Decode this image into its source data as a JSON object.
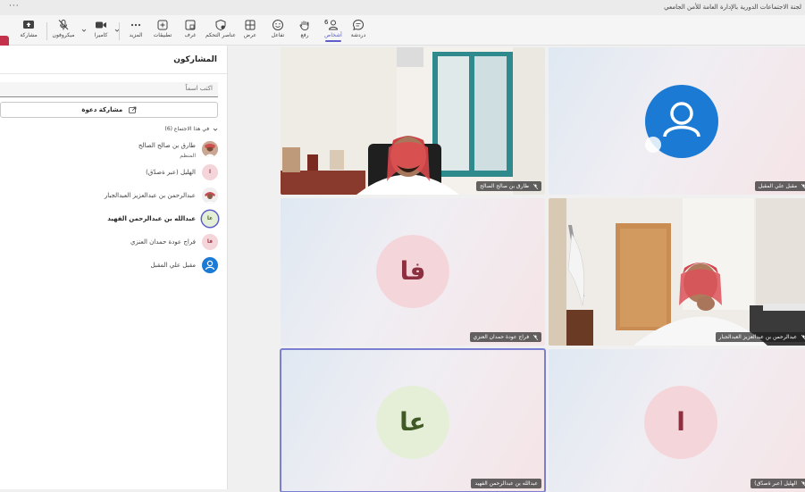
{
  "window": {
    "title": "لجنة الاجتماعات الدورية بالإدارة العامة للأمن الجامعي",
    "more_label": "···"
  },
  "toolbar": {
    "chat": "دردشة",
    "people": "أشخاص",
    "people_count": "6",
    "raise": "رفع",
    "react": "تفاعل",
    "view": "عرض",
    "controls": "عناصر التحكم",
    "rooms": "غرف",
    "apps": "تطبيقات",
    "more": "المزيد",
    "camera": "كاميرا",
    "mic": "ميكروفون",
    "share": "مشاركة"
  },
  "panel": {
    "title": "المشاركون",
    "search_placeholder": "اكتب اسماً",
    "invite_label": "مشاركة دعوة",
    "section_label": "في هذا الاجتماع (6)",
    "participants": [
      {
        "name": "طارق بن صالح الصالح",
        "role": "المنظم",
        "initials": "",
        "avatar": "photo"
      },
      {
        "name": "الهليل (عبر ةصدّق)",
        "role": "",
        "initials": "ا",
        "avatar": "initial"
      },
      {
        "name": "عبدالرحمن بن عبدالعزيز العبدالجبار",
        "role": "",
        "initials": "",
        "avatar": "photo"
      },
      {
        "name": "عبدالله بن عبدالرحمن الفهيد",
        "role": "",
        "initials": "عا",
        "avatar": "initial"
      },
      {
        "name": "فراج عودة حمدان العنزي",
        "role": "",
        "initials": "فا",
        "avatar": "initial"
      },
      {
        "name": "مقبل علي المقبل",
        "role": "",
        "initials": "",
        "avatar": "person"
      }
    ]
  },
  "tiles": [
    {
      "name": "طارق بن صالح الصالح",
      "kind": "video"
    },
    {
      "name": "مقبل علي المقبل",
      "kind": "person-avatar"
    },
    {
      "name": "فراج عودة حمدان العنزي",
      "kind": "initials",
      "initials": "فا"
    },
    {
      "name": "عبدالرحمن بن عبدالعزيز العبدالجبار",
      "kind": "video"
    },
    {
      "name": "عبدالله بن عبدالرحمن الفهيد",
      "kind": "initials",
      "initials": "عا"
    },
    {
      "name": "الهليل (عبر ةصدّق)",
      "kind": "initials",
      "initials": "ا"
    }
  ],
  "colors": {
    "accent": "#5b5fc7",
    "leave": "#c4314b",
    "avatar_blue": "#1a7ad4",
    "avatar_pink": "#f4d6da",
    "avatar_green": "#e5efd8"
  }
}
